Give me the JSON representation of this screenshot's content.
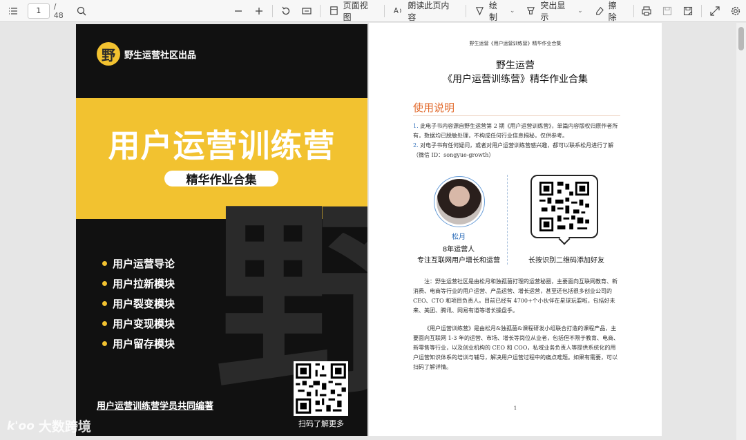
{
  "toolbar": {
    "page_current": "1",
    "page_total": "/ 48",
    "page_view_label": "页面视图",
    "read_aloud_label": "朗读此页内容",
    "draw_label": "绘制",
    "highlight_label": "突出显示",
    "erase_label": "擦除"
  },
  "cover": {
    "brand": "野生运营社区出品",
    "brand_logo_char": "野",
    "title": "用户运营训练营",
    "subtitle": "精华作业合集",
    "watermark_char": "野",
    "modules": [
      "用户运营导论",
      "用户拉新模块",
      "用户裂变模块",
      "用户变现模块",
      "用户留存模块"
    ],
    "footer": "用户运营训练营学员共同编著",
    "qr_caption": "扫码了解更多"
  },
  "site_watermark": {
    "logo": "k'oo",
    "text": "大数跨境"
  },
  "doc": {
    "header": "野生运营《用户运营训练营》精华作业合集",
    "title_line1": "野生运营",
    "title_line2": "《用户运营训练营》精华作业合集",
    "section_title": "使用说明",
    "note1_num": "1.",
    "note1": "此电子书内容源自野生运营第 2 期《用户运营训练营》，单篇内容版权归原作者所有，数据均已脱敏处理，不构成任何行业信息揭秘，仅供参考。",
    "note2_num": "2.",
    "note2": "对电子书有任何疑问，或者对用户运营训练营感兴趣，都可以联系松月进行了解 （微信 ID：songyue-growth）",
    "person_name": "松月",
    "person_role": "8年运营人",
    "person_desc": "专注互联网用户增长和运营",
    "qr_caption": "长按识别二维码添加好友",
    "para1": "注：野生运营社区是由松月和独孤菌打理的运营秘圈，主要面向互联网教育、新消费、电商等行业的用户运营、产品运营、增长运营，甚至还包括很多创业公司的 CEO、CTO 和项目负责人。目前已经有 4700+个小伙伴在星球玩耍啦，包括好未来、美团、腾讯、网易有道等增长操盘手。",
    "para2": "《用户运营训练营》是由松月&独孤菌&课程研发小组联合打造的课程产品，主要面向互联网 1-3 年的运营、市场、增长等岗位从业者，包括但不限于教育、电商、新零售等行业，以及创业机构的 CEO 和 COO，私域业务负责人等提供系统化的用户运营知识体系的培训与辅导，解决用户运营过程中的痛点难题。如果有需要，可以扫码了解详情。",
    "page_number": "1"
  },
  "colors": {
    "accent_yellow": "#f2c230",
    "section_orange": "#e26a2c",
    "link_blue": "#2a6bb8"
  }
}
